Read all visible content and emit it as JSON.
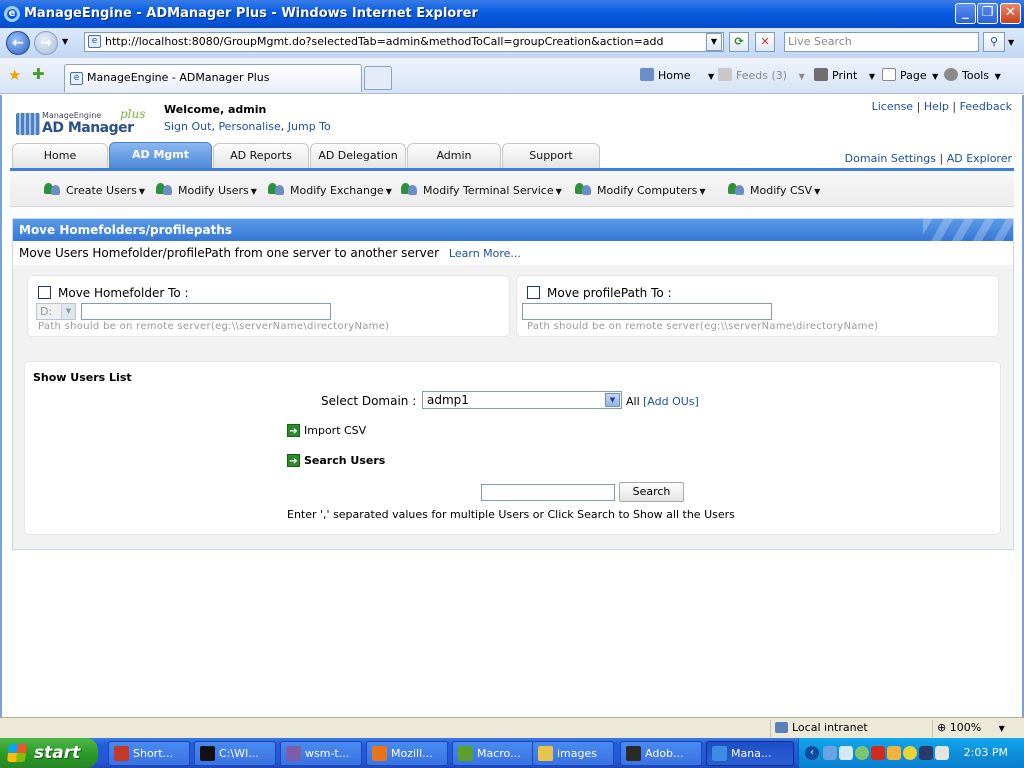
{
  "window": {
    "title": "ManageEngine - ADManager Plus - Windows Internet Explorer"
  },
  "browser": {
    "address": "http://localhost:8080/GroupMgmt.do?selectedTab=admin&methodToCall=groupCreation&action=add",
    "search_placeholder": "Live Search",
    "tab_title": "ManageEngine - ADManager Plus",
    "commands": {
      "home": "Home",
      "feeds": "Feeds (3)",
      "print": "Print",
      "page": "Page",
      "tools": "Tools"
    }
  },
  "header": {
    "logo_company": "ManageEngine",
    "logo_product": "AD Manager",
    "logo_plus": "plus",
    "welcome": "Welcome,  admin",
    "sign_out": "Sign Out",
    "personalise": "Personalise",
    "jump_to": "Jump To",
    "license": "License",
    "help": "Help",
    "feedback": "Feedback",
    "domain_settings": "Domain Settings",
    "ad_explorer": "AD Explorer",
    "sep": "|",
    "comma": ","
  },
  "main_tabs": [
    {
      "label": "Home"
    },
    {
      "label": "AD Mgmt"
    },
    {
      "label": "AD Reports"
    },
    {
      "label": "AD Delegation"
    },
    {
      "label": "Admin"
    },
    {
      "label": "Support"
    }
  ],
  "submenu": [
    {
      "label": "Create Users"
    },
    {
      "label": "Modify Users"
    },
    {
      "label": "Modify Exchange"
    },
    {
      "label": "Modify Terminal Service"
    },
    {
      "label": "Modify Computers"
    },
    {
      "label": "Modify CSV"
    }
  ],
  "panel": {
    "title": "Move Homefolders/profilepaths",
    "description": "Move Users Homefolder/profilePath from one server to another server",
    "learn_more": "Learn More...",
    "homefolder": {
      "label": "Move Homefolder To :",
      "drive": "D:",
      "path_value": "",
      "hint": "Path should be on remote server(eg:\\\\serverName\\directoryName)"
    },
    "profilepath": {
      "label": "Move profilePath To :",
      "path_value": "",
      "hint": "Path should be on remote server(eg:\\\\serverName\\directoryName)"
    },
    "users_list": {
      "heading": "Show Users List",
      "select_domain_label": "Select Domain :",
      "domain_value": "admp1",
      "all_label": "All",
      "add_ous": "[Add OUs]",
      "import_csv": "Import CSV",
      "search_users": "Search Users",
      "search_value": "",
      "search_button": "Search",
      "help_text": "Enter ',' separated values for multiple Users or Click Search to Show all the Users"
    }
  },
  "statusbar": {
    "zone": "Local intranet",
    "zoom": "100%"
  },
  "taskbar": {
    "start": "start",
    "tasks": [
      {
        "label": "Short...",
        "color": "#c0392b"
      },
      {
        "label": "C:\\WI...",
        "color": "#111111"
      },
      {
        "label": "wsm-t...",
        "color": "#7b5ea7"
      },
      {
        "label": "Mozill...",
        "color": "#e8741c"
      },
      {
        "label": "Macro...",
        "color": "#5aa02c"
      },
      {
        "label": "images",
        "color": "#e8c44a"
      },
      {
        "label": "Adob...",
        "color": "#2a2a2a"
      },
      {
        "label": "Mana...",
        "color": "#3a8de0"
      }
    ],
    "clock": "2:03 PM"
  }
}
